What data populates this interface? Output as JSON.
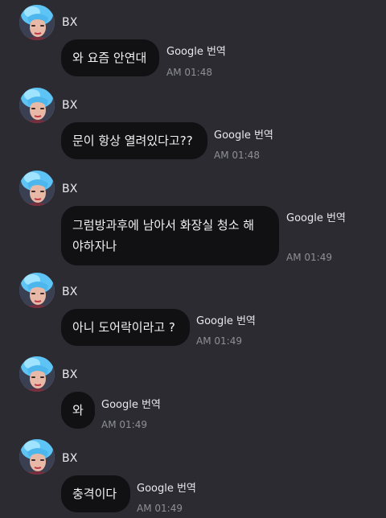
{
  "messages": [
    {
      "sender": "BX",
      "text": "와 요즘 안연대",
      "translate_label": "Google 번역",
      "time": "AM 01:48"
    },
    {
      "sender": "BX",
      "text": "문이 항상 열려있다고??",
      "translate_label": "Google 번역",
      "time": "AM 01:48"
    },
    {
      "sender": "BX",
      "text": "그럼방과후에 남아서 화장실 청소 해\n야하자나",
      "translate_label": "Google 번역",
      "time": "AM 01:49"
    },
    {
      "sender": "BX",
      "text": "아니 도어락이라고 ?",
      "translate_label": "Google 번역",
      "time": "AM 01:49"
    },
    {
      "sender": "BX",
      "text": "와",
      "translate_label": "Google 번역",
      "time": "AM 01:49"
    },
    {
      "sender": "BX",
      "text": "충격이다",
      "translate_label": "Google 번역",
      "time": "AM 01:49"
    }
  ],
  "colors": {
    "background": "#2b2b31",
    "bubble": "#111113",
    "timestamp": "#8f8f98"
  }
}
